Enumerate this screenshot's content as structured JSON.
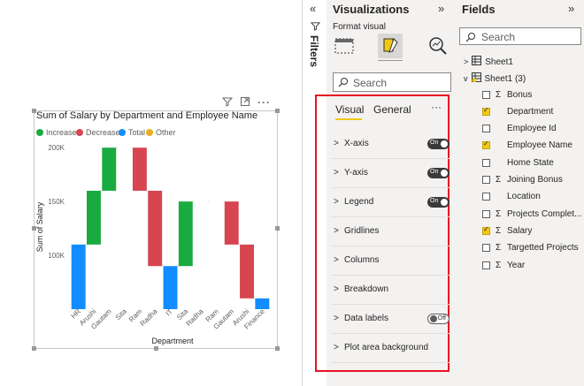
{
  "chart_data": {
    "type": "bar",
    "title": "Sum of Salary by Department and Employee Name",
    "xlabel": "Department",
    "ylabel": "Sum of Salary",
    "ylim": [
      50000,
      210000
    ],
    "yticks": [
      "100K",
      "150K",
      "200K"
    ],
    "ytick_values": [
      100000,
      150000,
      200000
    ],
    "legend": [
      {
        "name": "Increase",
        "color": "#1aab40"
      },
      {
        "name": "Decrease",
        "color": "#d64550"
      },
      {
        "name": "Total",
        "color": "#118dff"
      },
      {
        "name": "Other",
        "color": "#e8ae1e"
      }
    ],
    "categories": [
      "HR",
      "Arushi",
      "Gautam",
      "Sita",
      "Ram",
      "Radha",
      "IT",
      "Sita",
      "Radha",
      "Ram",
      "Gautam",
      "Arushi",
      "Finance"
    ],
    "bars": [
      {
        "kind": "Total",
        "start": 0,
        "end": 110000
      },
      {
        "kind": "Increase",
        "start": 110000,
        "end": 160000
      },
      {
        "kind": "Increase",
        "start": 160000,
        "end": 200000
      },
      {
        "kind": "Increase",
        "start": 200000,
        "end": 200000
      },
      {
        "kind": "Decrease",
        "start": 200000,
        "end": 160000
      },
      {
        "kind": "Decrease",
        "start": 160000,
        "end": 90000
      },
      {
        "kind": "Total",
        "start": 0,
        "end": 90000
      },
      {
        "kind": "Increase",
        "start": 90000,
        "end": 150000
      },
      {
        "kind": "Increase",
        "start": 150000,
        "end": 150000
      },
      {
        "kind": "Increase",
        "start": 150000,
        "end": 150000
      },
      {
        "kind": "Decrease",
        "start": 150000,
        "end": 110000
      },
      {
        "kind": "Decrease",
        "start": 110000,
        "end": 60000
      },
      {
        "kind": "Total",
        "start": 0,
        "end": 60000
      }
    ]
  },
  "filters": {
    "label": "Filters"
  },
  "visualizations": {
    "title": "Visualizations",
    "format_label": "Format visual",
    "search_placeholder": "Search",
    "tabs": [
      "Visual",
      "General"
    ],
    "more": "···",
    "sections": [
      {
        "label": "X-axis",
        "toggle": "On"
      },
      {
        "label": "Y-axis",
        "toggle": "On"
      },
      {
        "label": "Legend",
        "toggle": "On"
      },
      {
        "label": "Gridlines",
        "toggle": null
      },
      {
        "label": "Columns",
        "toggle": null
      },
      {
        "label": "Breakdown",
        "toggle": null
      },
      {
        "label": "Data labels",
        "toggle": "Off"
      },
      {
        "label": "Plot area background",
        "toggle": null
      }
    ]
  },
  "fields": {
    "title": "Fields",
    "search_placeholder": "Search",
    "tables": [
      "Sheet1",
      "Sheet1 (3)"
    ],
    "items": [
      {
        "name": "Bonus",
        "sigma": true,
        "checked": false
      },
      {
        "name": "Department",
        "sigma": false,
        "checked": true
      },
      {
        "name": "Employee Id",
        "sigma": false,
        "checked": false
      },
      {
        "name": "Employee Name",
        "sigma": false,
        "checked": true
      },
      {
        "name": "Home State",
        "sigma": false,
        "checked": false
      },
      {
        "name": "Joining Bonus",
        "sigma": true,
        "checked": false
      },
      {
        "name": "Location",
        "sigma": false,
        "checked": false
      },
      {
        "name": "Projects Complet...",
        "sigma": true,
        "checked": false
      },
      {
        "name": "Salary",
        "sigma": true,
        "checked": true
      },
      {
        "name": "Targetted Projects",
        "sigma": true,
        "checked": false
      },
      {
        "name": "Year",
        "sigma": true,
        "checked": false
      }
    ]
  },
  "icons": {
    "filter": "funnel-icon",
    "focus": "focus-mode-icon",
    "more": "more-options-icon"
  }
}
